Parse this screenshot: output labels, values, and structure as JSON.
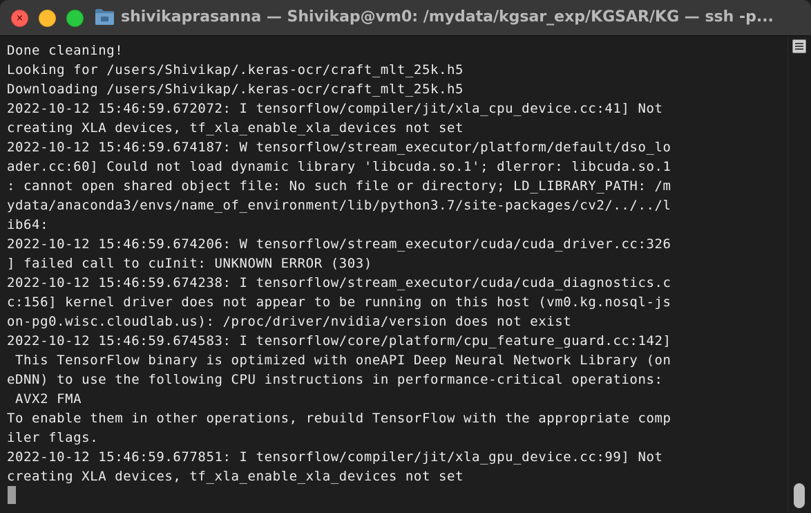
{
  "window": {
    "title": "shivikaprasanna — Shivikap@vm0: /mydata/kgsar_exp/KGSAR/KG — ssh -p...",
    "close_glyph": "×",
    "minimize_glyph": "",
    "zoom_glyph": ""
  },
  "icons": {
    "title_icon": "folder-icon",
    "scroll_menu_icon": "list-lines-icon"
  },
  "colors": {
    "background": "#1e1e1e",
    "titlebar": "#383838",
    "text": "#ececec",
    "close": "#ff5f57",
    "minimize": "#febc2e",
    "zoom": "#28c840"
  },
  "terminal": {
    "output": "Done cleaning!\nLooking for /users/Shivikap/.keras-ocr/craft_mlt_25k.h5\nDownloading /users/Shivikap/.keras-ocr/craft_mlt_25k.h5\n2022-10-12 15:46:59.672072: I tensorflow/compiler/jit/xla_cpu_device.cc:41] Not\ncreating XLA devices, tf_xla_enable_xla_devices not set\n2022-10-12 15:46:59.674187: W tensorflow/stream_executor/platform/default/dso_lo\nader.cc:60] Could not load dynamic library 'libcuda.so.1'; dlerror: libcuda.so.1\n: cannot open shared object file: No such file or directory; LD_LIBRARY_PATH: /m\nydata/anaconda3/envs/name_of_environment/lib/python3.7/site-packages/cv2/../../l\nib64:\n2022-10-12 15:46:59.674206: W tensorflow/stream_executor/cuda/cuda_driver.cc:326\n] failed call to cuInit: UNKNOWN ERROR (303)\n2022-10-12 15:46:59.674238: I tensorflow/stream_executor/cuda/cuda_diagnostics.c\nc:156] kernel driver does not appear to be running on this host (vm0.kg.nosql-js\non-pg0.wisc.cloudlab.us): /proc/driver/nvidia/version does not exist\n2022-10-12 15:46:59.674583: I tensorflow/core/platform/cpu_feature_guard.cc:142]\n This TensorFlow binary is optimized with oneAPI Deep Neural Network Library (on\neDNN) to use the following CPU instructions in performance-critical operations:\n AVX2 FMA\nTo enable them in other operations, rebuild TensorFlow with the appropriate comp\niler flags.\n2022-10-12 15:46:59.677851: I tensorflow/compiler/jit/xla_gpu_device.cc:99] Not\ncreating XLA devices, tf_xla_enable_xla_devices not set"
  }
}
